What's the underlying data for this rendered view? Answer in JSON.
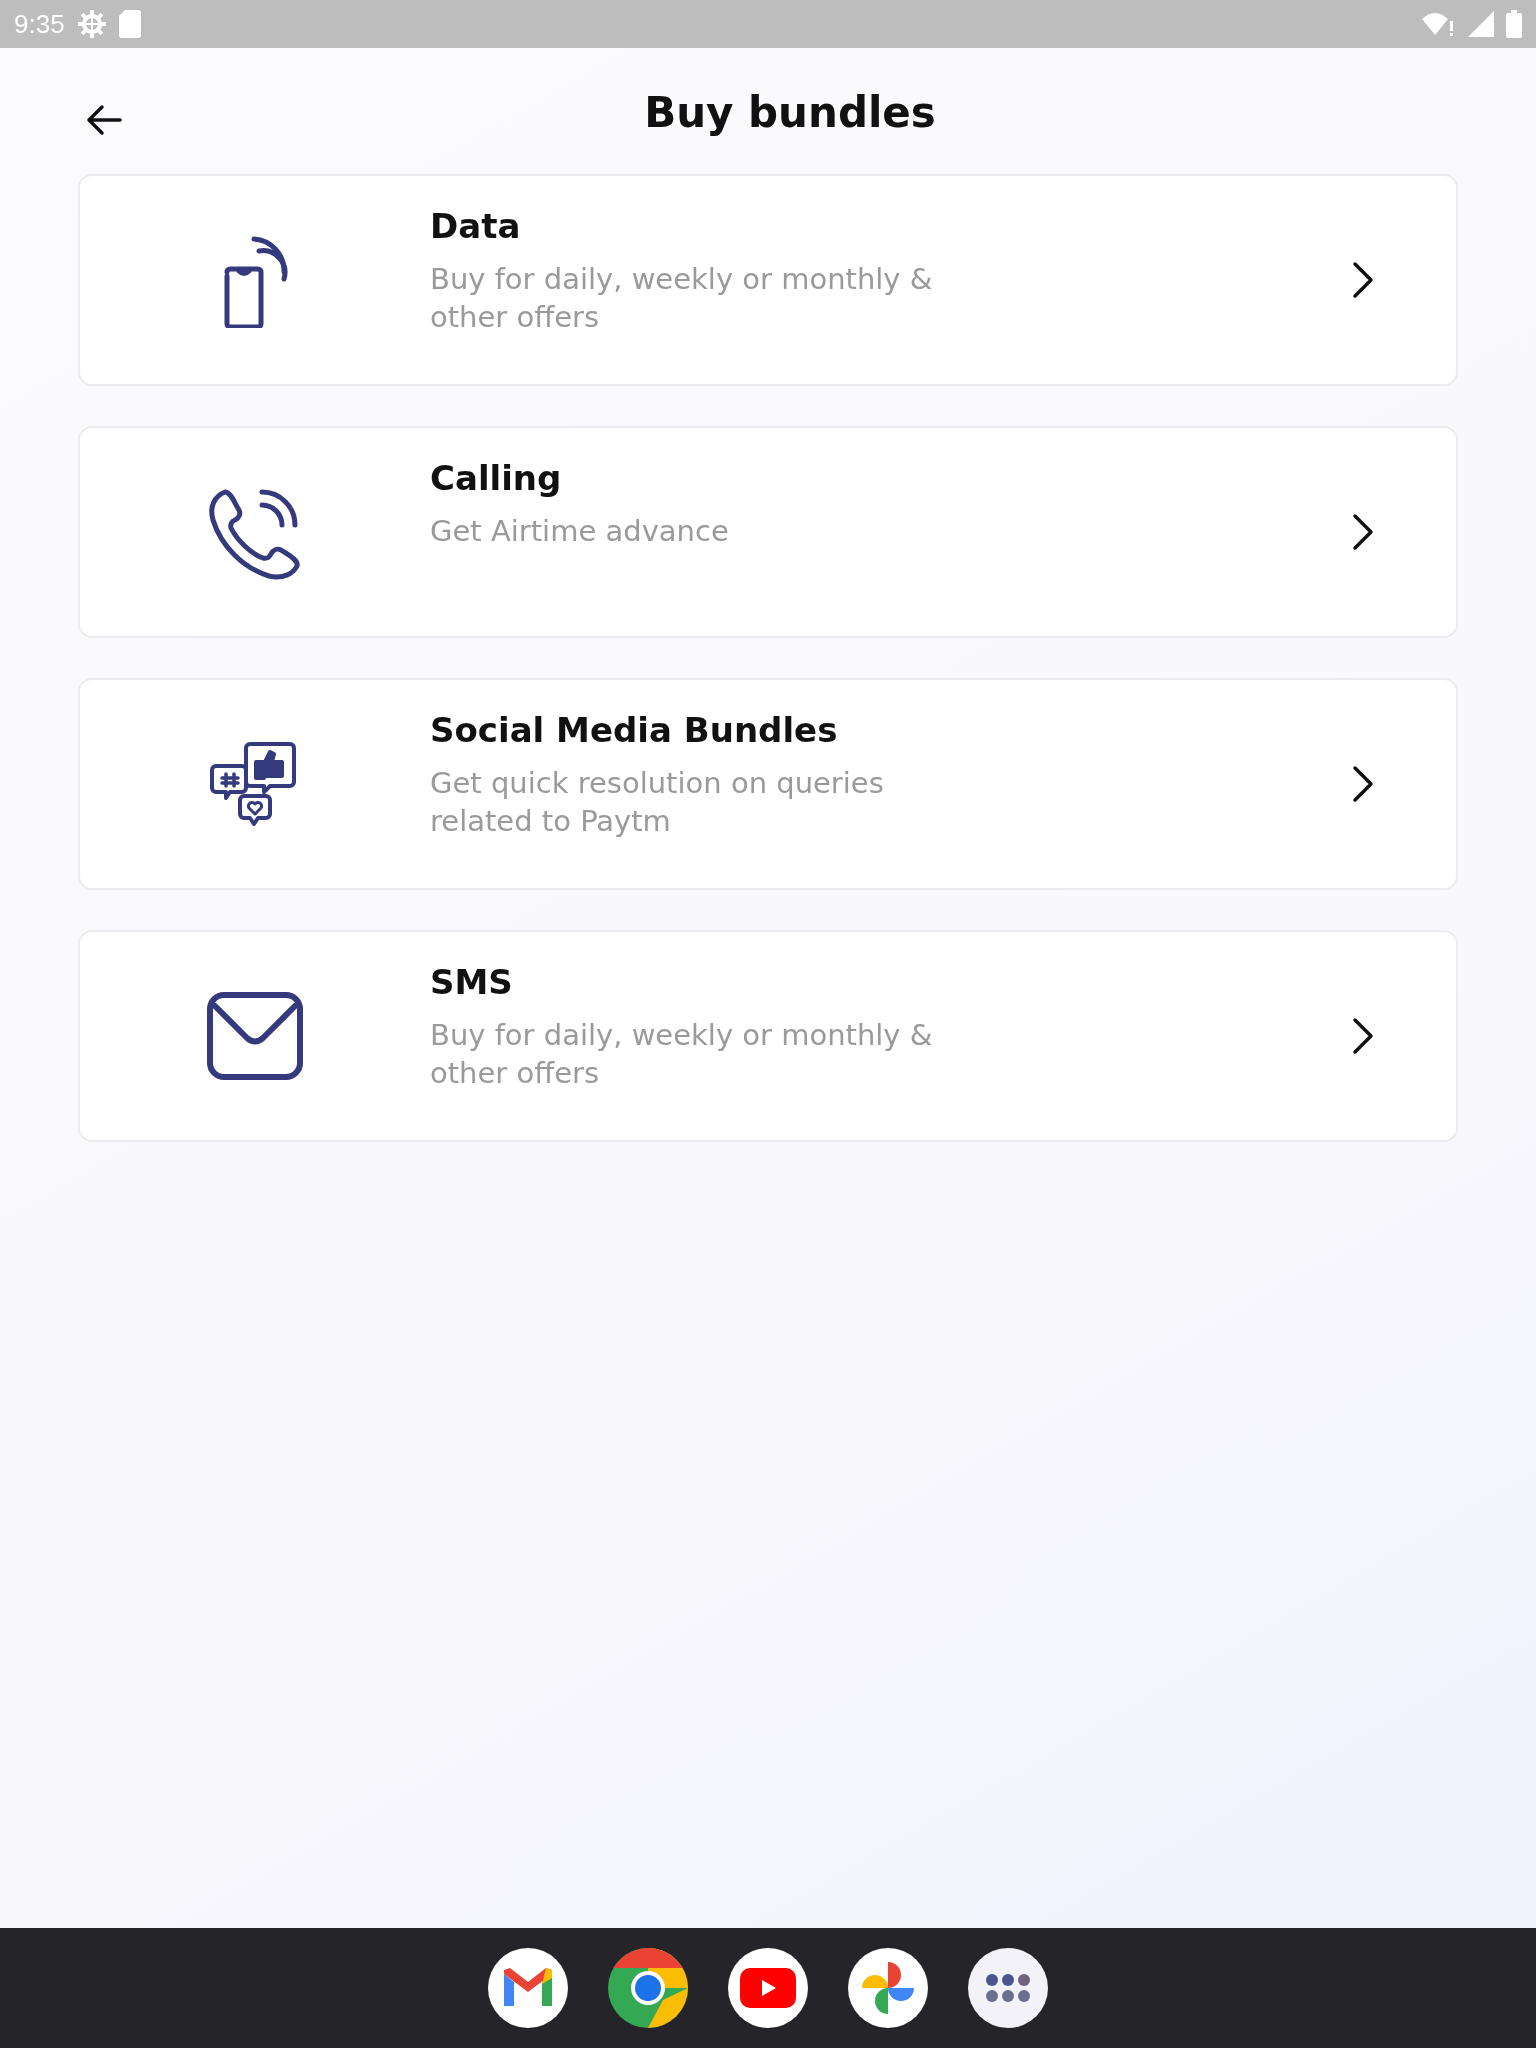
{
  "status_bar": {
    "time": "9:35"
  },
  "header": {
    "title": "Buy bundles"
  },
  "items": [
    {
      "kind": "data",
      "title": "Data",
      "subtitle": "Buy for daily, weekly or monthly &\nother offers"
    },
    {
      "kind": "calling",
      "title": "Calling",
      "subtitle": "Get Airtime advance"
    },
    {
      "kind": "social",
      "title": "Social Media Bundles",
      "subtitle": "Get quick resolution on queries\nrelated to Paytm"
    },
    {
      "kind": "sms",
      "title": "SMS",
      "subtitle": "Buy for daily, weekly or monthly &\nother offers"
    }
  ],
  "dock": [
    {
      "kind": "mail"
    },
    {
      "kind": "browser"
    },
    {
      "kind": "video"
    },
    {
      "kind": "photos"
    },
    {
      "kind": "apps"
    }
  ]
}
